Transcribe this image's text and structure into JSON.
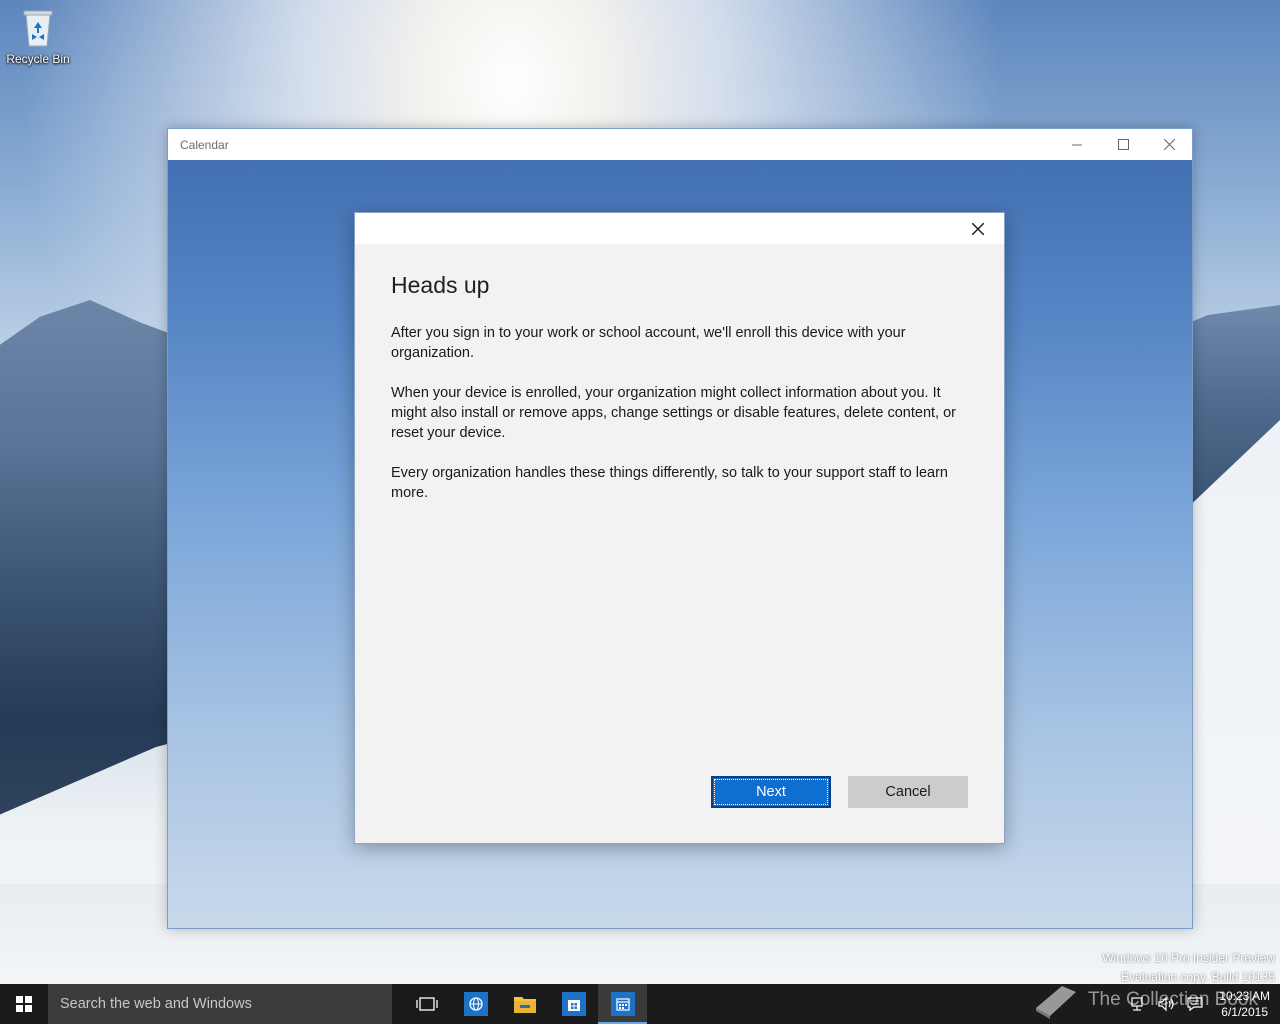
{
  "desktop": {
    "icons": [
      {
        "label": "Recycle Bin",
        "icon": "recycle-bin-icon"
      }
    ]
  },
  "window": {
    "title": "Calendar",
    "controls": {
      "minimize": "minimize-icon",
      "maximize": "maximize-icon",
      "close": "close-icon"
    }
  },
  "dialog": {
    "title": "Heads up",
    "paragraphs": [
      "After you sign in to your work or school account, we'll enroll this device with your organization.",
      "When your device is enrolled, your organization might collect information about you. It might also install or remove apps, change settings or disable features, delete content, or reset your device.",
      "Every organization handles these things differently, so talk to your support staff to learn more."
    ],
    "next_label": "Next",
    "cancel_label": "Cancel"
  },
  "watermark": {
    "line1": "Windows 10 Pro Insider Preview",
    "line2": "Evaluation copy. Build 10135",
    "book_text": "The Collection Book"
  },
  "taskbar": {
    "search_placeholder": "Search the web and Windows",
    "pinned": [
      {
        "name": "task-view",
        "icon": "task-view-icon"
      },
      {
        "name": "edge",
        "icon": "browser-icon"
      },
      {
        "name": "file-explorer",
        "icon": "folder-icon"
      },
      {
        "name": "store",
        "icon": "store-icon"
      },
      {
        "name": "calendar",
        "icon": "calendar-icon",
        "active": true
      }
    ],
    "clock": {
      "time": "10:23 AM",
      "date": "6/1/2015"
    }
  },
  "colors": {
    "accent": "#0f6fd1",
    "taskbar": "#1b1b1b",
    "search": "#3b3b3b",
    "dialog_bg": "#f2f2f2"
  }
}
